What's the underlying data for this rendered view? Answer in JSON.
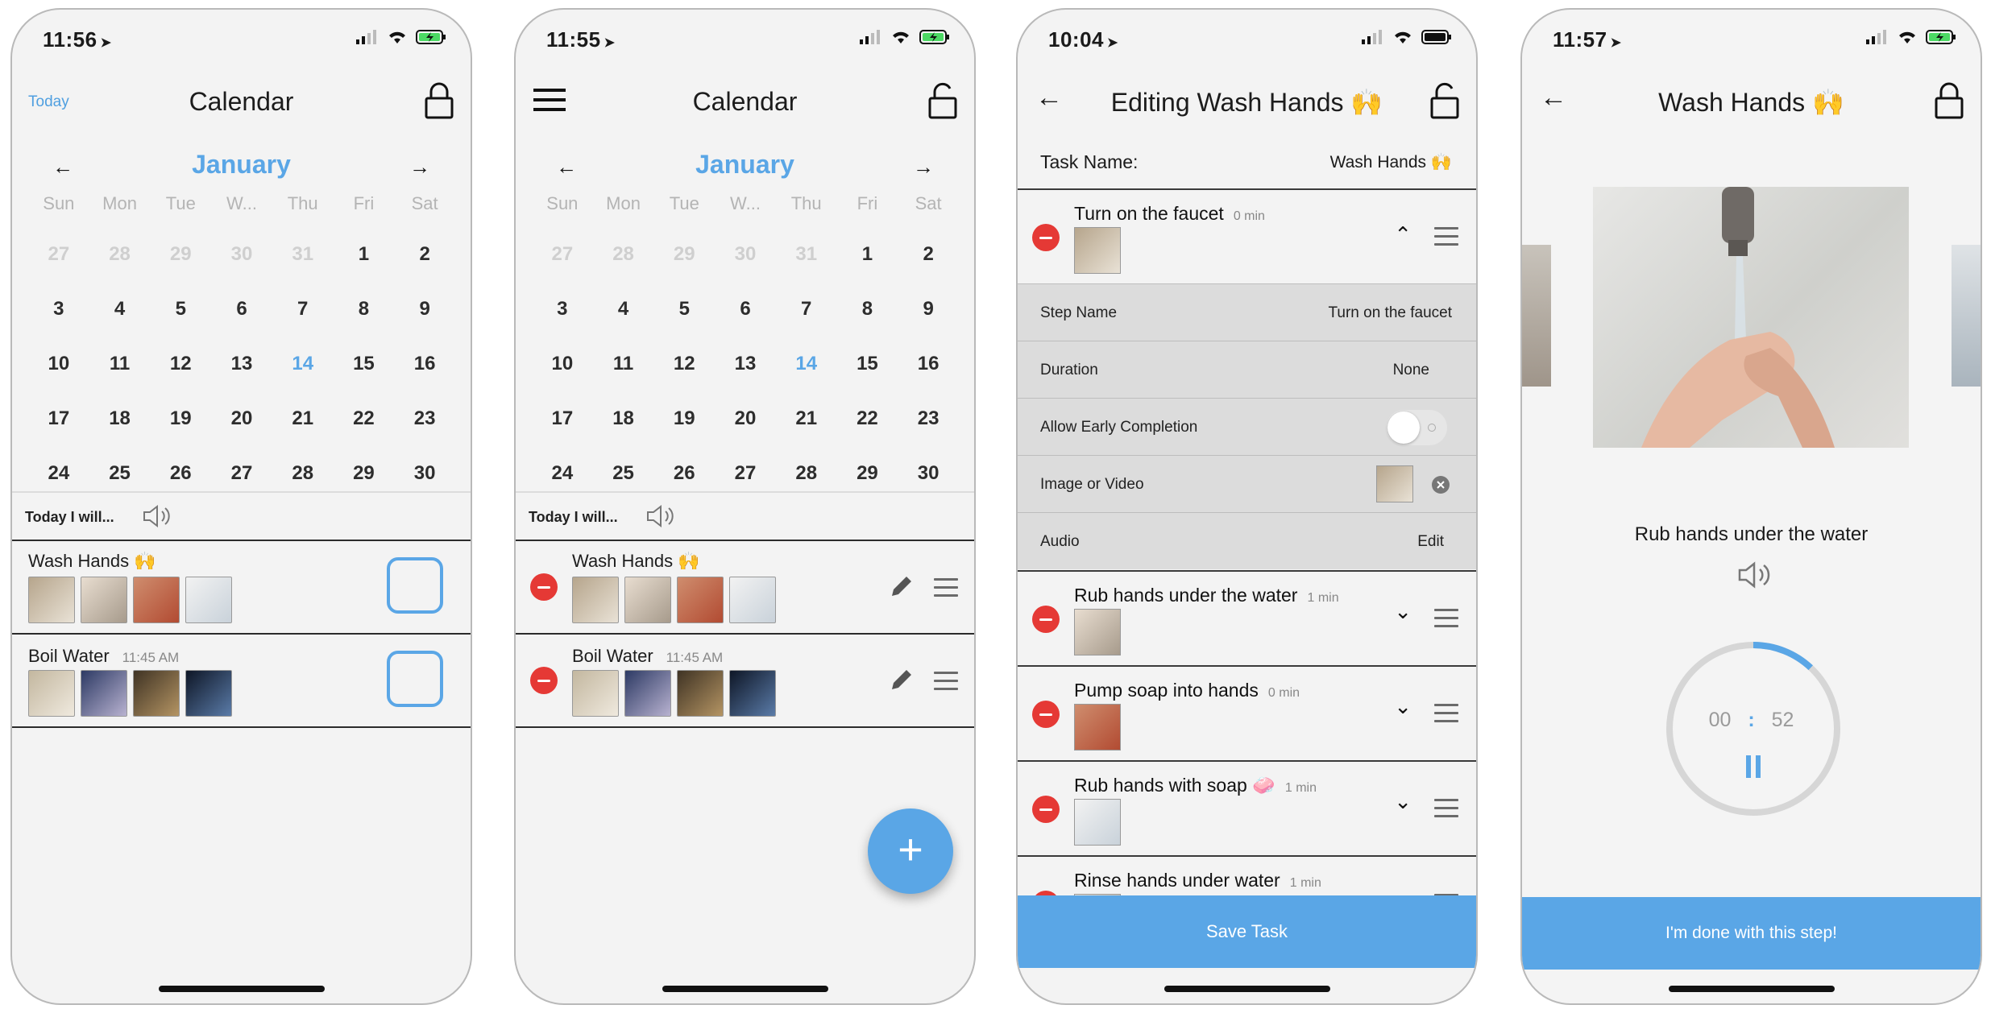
{
  "screens": [
    {
      "time": "11:56",
      "title": "Calendar",
      "left_label": "Today",
      "month": "January",
      "section": "Today I will...",
      "tasks": [
        {
          "name": "Wash Hands 🙌",
          "time": ""
        },
        {
          "name": "Boil Water",
          "time": "11:45 AM"
        }
      ]
    },
    {
      "time": "11:55",
      "title": "Calendar",
      "month": "January",
      "section": "Today I will...",
      "tasks": [
        {
          "name": "Wash Hands 🙌",
          "time": ""
        },
        {
          "name": "Boil Water",
          "time": "11:45 AM"
        }
      ],
      "fab": "+"
    },
    {
      "time": "10:04",
      "title": "Editing Wash Hands 🙌",
      "task_name_label": "Task Name:",
      "task_name_value": "Wash Hands 🙌",
      "steps": [
        {
          "name": "Turn on the faucet",
          "duration": "0 min"
        },
        {
          "name": "Rub hands under the water",
          "duration": "1 min"
        },
        {
          "name": "Pump soap into hands",
          "duration": "0 min"
        },
        {
          "name": "Rub hands with soap 🧼",
          "duration": "1 min"
        },
        {
          "name": "Rinse hands under water",
          "duration": "1 min"
        }
      ],
      "details": [
        {
          "key": "Step Name",
          "value": "Turn on the faucet"
        },
        {
          "key": "Duration",
          "value": "None"
        },
        {
          "key": "Allow Early Completion",
          "value": ""
        },
        {
          "key": "Image or Video",
          "value": ""
        },
        {
          "key": "Audio",
          "value": "Edit"
        }
      ],
      "save": "Save Task"
    },
    {
      "time": "11:57",
      "title": "Wash Hands 🙌",
      "caption": "Rub hands under the water",
      "min": "00",
      "sep": ":",
      "sec": "52",
      "progress": 0.12,
      "done": "I'm done with this step!"
    }
  ],
  "calendar": {
    "weekdays": [
      "Sun",
      "Mon",
      "Tue",
      "W...",
      "Thu",
      "Fri",
      "Sat"
    ],
    "days": [
      "27",
      "28",
      "29",
      "30",
      "31",
      "1",
      "2",
      "3",
      "4",
      "5",
      "6",
      "7",
      "8",
      "9",
      "10",
      "11",
      "12",
      "13",
      "14",
      "15",
      "16",
      "17",
      "18",
      "19",
      "20",
      "21",
      "22",
      "23",
      "24",
      "25",
      "26",
      "27",
      "28",
      "29",
      "30"
    ],
    "muted_count": 5,
    "today": "14"
  },
  "colors": {
    "accent": "#5aa6e6",
    "delete": "#e53935"
  }
}
